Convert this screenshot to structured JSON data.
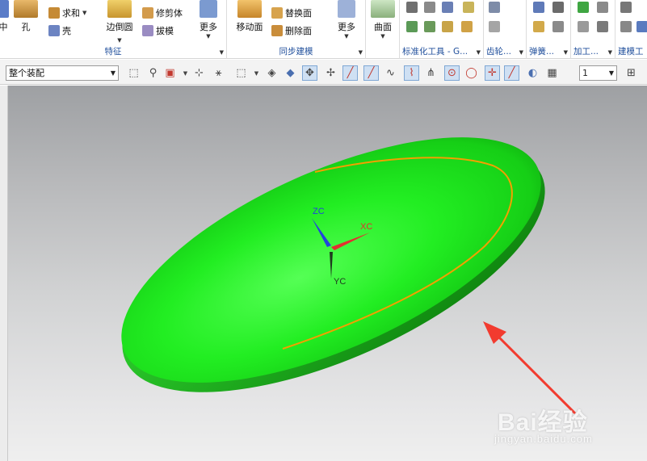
{
  "ribbon": {
    "groups": [
      {
        "label": "特征"
      },
      {
        "label": "同步建模"
      },
      {
        "label": "标准化工具 - G..."
      },
      {
        "label": "齿轮..."
      },
      {
        "label": "弹簧..."
      },
      {
        "label": "加工..."
      },
      {
        "label": "建模工"
      }
    ],
    "feature": {
      "item_left_label": "中",
      "hole_label": "孔",
      "unite_label": "求和",
      "shell_label": "壳",
      "edge_blend_label": "边倒圆",
      "trim_body_label": "修剪体",
      "draft_label": "拔模",
      "more_label": "更多"
    },
    "sync": {
      "move_face_label": "移动面",
      "replace_face_label": "替换面",
      "delete_face_label": "删除面",
      "more_label": "更多"
    },
    "surface_label": "曲面"
  },
  "toolbar": {
    "selection_filter": "整个装配",
    "layer_value": "1"
  },
  "viewport": {
    "axis": {
      "zc": "ZC",
      "xc": "XC",
      "yc": "YC"
    },
    "colors": {
      "body": "#22ee22",
      "curve": "#f2a000",
      "arrow": "#f23b2f"
    }
  },
  "watermark": {
    "brand": "Bai经验",
    "url": "jingyan.baidu.com"
  }
}
